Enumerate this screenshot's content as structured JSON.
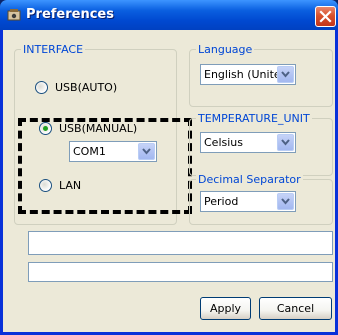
{
  "window": {
    "title": "Preferences",
    "icons": {
      "app": "app-icon",
      "close": "close-x-icon"
    }
  },
  "interface_group": {
    "legend": "INTERFACE",
    "options": {
      "usb_auto": {
        "label": "USB(AUTO)",
        "selected": false
      },
      "usb_manual": {
        "label": "USB(MANUAL)",
        "selected": true
      },
      "lan": {
        "label": "LAN",
        "selected": false
      }
    },
    "port_select": {
      "value": "COM1"
    }
  },
  "language_group": {
    "legend": "Language",
    "select_value": "English (United"
  },
  "temperature_group": {
    "legend": "TEMPERATURE_UNIT",
    "select_value": "Celsius"
  },
  "decimal_group": {
    "legend": "Decimal Separator",
    "select_value": "Period"
  },
  "text_fields": {
    "field_1": "",
    "field_2": ""
  },
  "buttons": {
    "apply": "Apply",
    "cancel": "Cancel"
  },
  "colors": {
    "titlebar": "#0054e3",
    "dialog_bg": "#ece9d8",
    "legend_text": "#0046d5",
    "selected_radio": "#21a121",
    "close_button": "#d8512c"
  }
}
